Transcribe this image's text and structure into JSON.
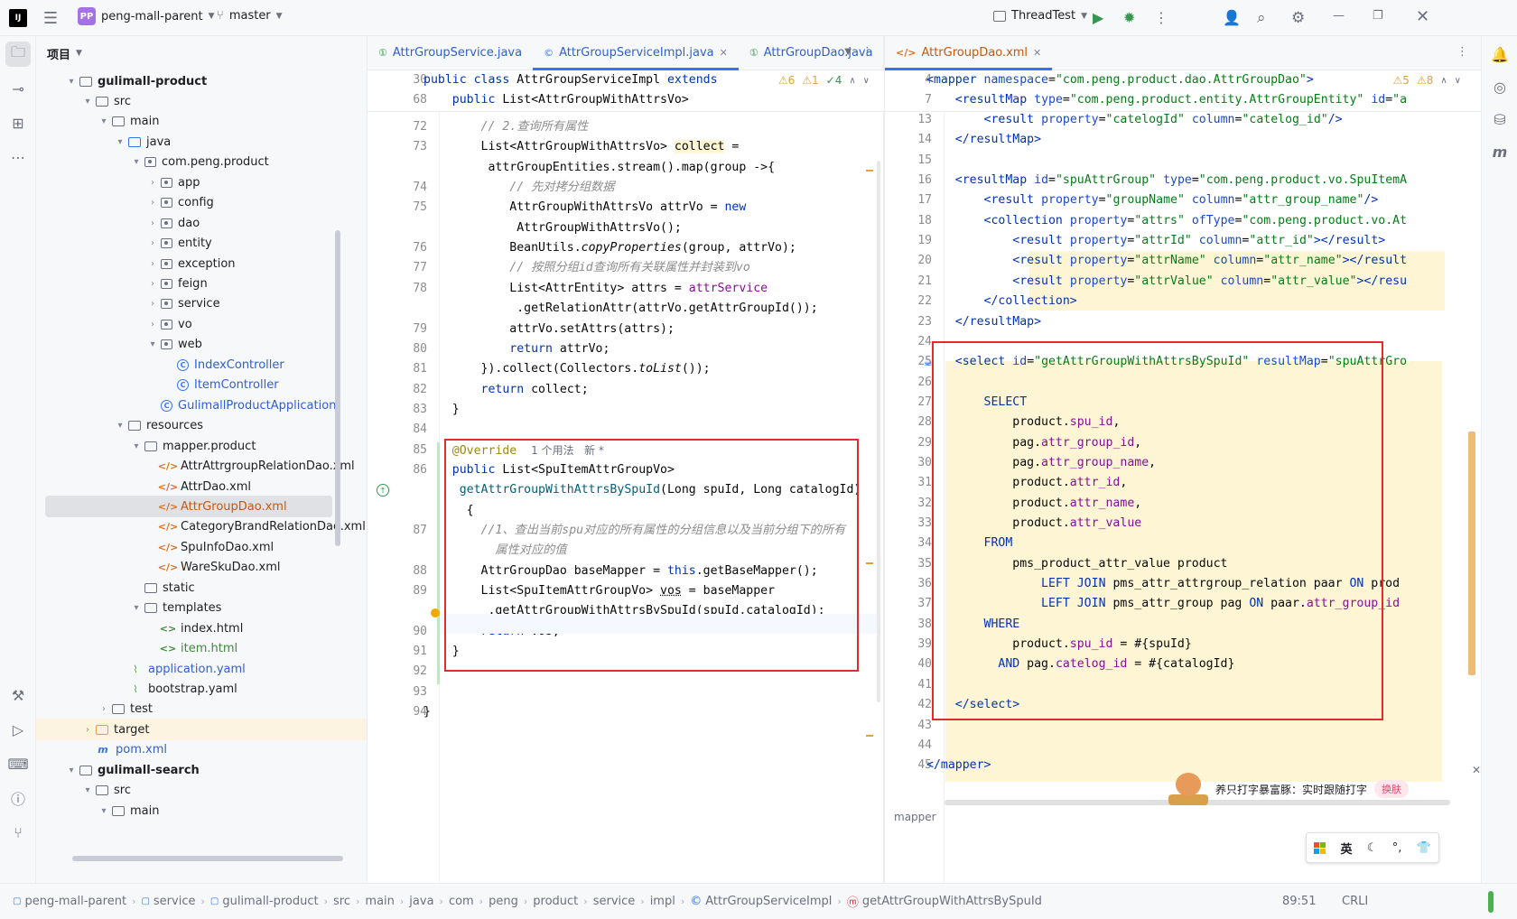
{
  "titlebar": {
    "project_badge": "PP",
    "project_name": "peng-mall-parent",
    "branch": "master",
    "run_config": "ThreadTest"
  },
  "project_panel": {
    "title": "项目",
    "tree": [
      {
        "label": "gulimall-product",
        "depth": 2,
        "icon": "folder",
        "arrow": "▾",
        "bold": true
      },
      {
        "label": "src",
        "depth": 3,
        "icon": "folder",
        "arrow": "▾"
      },
      {
        "label": "main",
        "depth": 4,
        "icon": "folder",
        "arrow": "▾"
      },
      {
        "label": "java",
        "depth": 5,
        "icon": "folder-blue",
        "arrow": "▾"
      },
      {
        "label": "com.peng.product",
        "depth": 6,
        "icon": "package",
        "arrow": "▾"
      },
      {
        "label": "app",
        "depth": 7,
        "icon": "package",
        "arrow": "›"
      },
      {
        "label": "config",
        "depth": 7,
        "icon": "package",
        "arrow": "›"
      },
      {
        "label": "dao",
        "depth": 7,
        "icon": "package",
        "arrow": "›"
      },
      {
        "label": "entity",
        "depth": 7,
        "icon": "package",
        "arrow": "›"
      },
      {
        "label": "exception",
        "depth": 7,
        "icon": "package",
        "arrow": "›"
      },
      {
        "label": "feign",
        "depth": 7,
        "icon": "package",
        "arrow": "›"
      },
      {
        "label": "service",
        "depth": 7,
        "icon": "package",
        "arrow": "›"
      },
      {
        "label": "vo",
        "depth": 7,
        "icon": "package",
        "arrow": "›"
      },
      {
        "label": "web",
        "depth": 7,
        "icon": "package",
        "arrow": "▾"
      },
      {
        "label": "IndexController",
        "depth": 8,
        "icon": "class",
        "arrow": "",
        "blue": true
      },
      {
        "label": "ItemController",
        "depth": 8,
        "icon": "class",
        "arrow": "",
        "blue": true
      },
      {
        "label": "GulimallProductApplication",
        "depth": 7,
        "icon": "class",
        "arrow": "",
        "blue": true
      },
      {
        "label": "resources",
        "depth": 5,
        "icon": "folder",
        "arrow": "▾"
      },
      {
        "label": "mapper.product",
        "depth": 6,
        "icon": "folder",
        "arrow": "▾"
      },
      {
        "label": "AttrAttrgroupRelationDao.xml",
        "depth": 7,
        "icon": "xml",
        "arrow": ""
      },
      {
        "label": "AttrDao.xml",
        "depth": 7,
        "icon": "xml",
        "arrow": ""
      },
      {
        "label": "AttrGroupDao.xml",
        "depth": 7,
        "icon": "xml",
        "arrow": "",
        "selected": true,
        "orange": true
      },
      {
        "label": "CategoryBrandRelationDao.xml",
        "depth": 7,
        "icon": "xml",
        "arrow": ""
      },
      {
        "label": "SpuInfoDao.xml",
        "depth": 7,
        "icon": "xml",
        "arrow": ""
      },
      {
        "label": "WareSkuDao.xml",
        "depth": 7,
        "icon": "xml",
        "arrow": ""
      },
      {
        "label": "static",
        "depth": 6,
        "icon": "folder",
        "arrow": ""
      },
      {
        "label": "templates",
        "depth": 6,
        "icon": "folder",
        "arrow": "▾"
      },
      {
        "label": "index.html",
        "depth": 7,
        "icon": "html",
        "arrow": ""
      },
      {
        "label": "item.html",
        "depth": 7,
        "icon": "html",
        "arrow": "",
        "green": true
      },
      {
        "label": "application.yaml",
        "depth": 5,
        "icon": "yaml",
        "arrow": "",
        "blue": true
      },
      {
        "label": "bootstrap.yaml",
        "depth": 5,
        "icon": "yaml",
        "arrow": ""
      },
      {
        "label": "test",
        "depth": 4,
        "icon": "folder",
        "arrow": "›"
      },
      {
        "label": "target",
        "depth": 3,
        "icon": "folder-orange",
        "arrow": "›",
        "highlight": true
      },
      {
        "label": "pom.xml",
        "depth": 3,
        "icon": "maven",
        "arrow": "",
        "blue": true
      },
      {
        "label": "gulimall-search",
        "depth": 2,
        "icon": "folder",
        "arrow": "▾",
        "bold": true
      },
      {
        "label": "src",
        "depth": 3,
        "icon": "folder",
        "arrow": "▾"
      },
      {
        "label": "main",
        "depth": 4,
        "icon": "folder",
        "arrow": "▾"
      }
    ]
  },
  "left_tabs": [
    {
      "label": "AttrGroupService.java",
      "icon": "interface"
    },
    {
      "label": "AttrGroupServiceImpl.java",
      "icon": "class",
      "active": true
    },
    {
      "label": "AttrGroupDao.java",
      "icon": "interface"
    }
  ],
  "right_tabs": [
    {
      "label": "AttrGroupDao.xml",
      "icon": "xml",
      "active": true
    }
  ],
  "left_editor": {
    "inspections": {
      "warn1": "6",
      "warn2": "1",
      "ok": "4"
    },
    "sticky": [
      {
        "ln": "30",
        "html": "<span class='kw'>public class</span> AttrGroupServiceImpl <span class='kw'>extends</span>"
      },
      {
        "ln": "68",
        "html": "    <span class='kw'>public</span> List&lt;AttrGroupWithAttrsVo&gt;"
      }
    ],
    "lines": [
      {
        "ln": "72",
        "html": "        <span class='cm'>// 2.查询所有属性</span>"
      },
      {
        "ln": "73",
        "html": "        List&lt;AttrGroupWithAttrsVo&gt; <span style='background:#fdf5d4'>collect</span> ="
      },
      {
        "ln": "",
        "html": "         attrGroupEntities.stream().map(group -&gt;{"
      },
      {
        "ln": "74",
        "html": "            <span class='cm'>// 先对拷分组数据</span>"
      },
      {
        "ln": "75",
        "html": "            AttrGroupWithAttrsVo attrVo = <span class='kw'>new</span>"
      },
      {
        "ln": "",
        "html": "             AttrGroupWithAttrsVo();"
      },
      {
        "ln": "76",
        "html": "            BeanUtils.<span class='ital'>copyProperties</span>(group, attrVo);"
      },
      {
        "ln": "77",
        "html": "            <span class='cm'>// 按照分组id查询所有关联属性并封装到vo</span>"
      },
      {
        "ln": "78",
        "html": "            List&lt;AttrEntity&gt; attrs = <span class='fld'>attrService</span>"
      },
      {
        "ln": "",
        "html": "             .getRelationAttr(attrVo.getAttrGroupId());"
      },
      {
        "ln": "79",
        "html": "            attrVo.setAttrs(attrs);"
      },
      {
        "ln": "80",
        "html": "            <span class='kw'>return</span> attrVo;"
      },
      {
        "ln": "81",
        "html": "        }).collect(Collectors.<span class='ital'>toList</span>());"
      },
      {
        "ln": "82",
        "html": "        <span class='kw'>return</span> collect;"
      },
      {
        "ln": "83",
        "html": "    }"
      },
      {
        "ln": "84",
        "html": ""
      },
      {
        "ln": "85",
        "html": "    <span class='an'>@Override</span>  <span style='color:#6c707e;font-family:DejaVu Sans,sans-serif;font-size:12px'>1 个用法   新 *</span>"
      },
      {
        "ln": "86",
        "html": "    <span class='kw'>public</span> List&lt;SpuItemAttrGroupVo&gt;"
      },
      {
        "ln": "",
        "html": "     <span class='mth'>getAttrGroupWithAttrsBySpuId</span>(Long spuId, Long catalogId)"
      },
      {
        "ln": "",
        "html": "      {"
      },
      {
        "ln": "87",
        "html": "        <span class='cm'>//1、查出当前spu对应的所有属性的分组信息以及当前分组下的所有</span>"
      },
      {
        "ln": "",
        "html": "          <span class='cm'>属性对应的值</span>"
      },
      {
        "ln": "88",
        "html": "        AttrGroupDao baseMapper = <span class='kw'>this</span>.getBaseMapper();"
      },
      {
        "ln": "89",
        "html": "        List&lt;SpuItemAttrGroupVo&gt; <span style='text-decoration:underline dotted'>vos</span> = baseMapper"
      },
      {
        "ln": "",
        "html": "         .getAttrGroupWithAttrsBySpuId(spuId,catalogId);"
      },
      {
        "ln": "90",
        "html": "        <span class='kw'>return</span> vos;"
      },
      {
        "ln": "91",
        "html": "    }"
      },
      {
        "ln": "92",
        "html": ""
      },
      {
        "ln": "93",
        "html": ""
      },
      {
        "ln": "94",
        "html": "}"
      }
    ]
  },
  "right_editor": {
    "inspections": {
      "warn": "5",
      "ok": "8"
    },
    "sticky": [
      {
        "ln": "4",
        "html": "<span class='tg'>&lt;mapper</span> <span class='at'>namespace</span>=<span class='str'>\"com.peng.product.dao.AttrGroupDao\"</span><span class='tg'>&gt;</span>"
      },
      {
        "ln": "7",
        "html": "    <span class='tg'>&lt;resultMap</span> <span class='at'>type</span>=<span class='str'>\"com.peng.product.entity.AttrGroupEntity\"</span> <span class='at'>id</span>=<span class='str'>\"a</span>"
      }
    ],
    "lines": [
      {
        "ln": "13",
        "html": "        <span class='tg'>&lt;result</span> <span class='at'>property</span>=<span class='str'>\"catelogId\"</span> <span class='at'>column</span>=<span class='str'>\"catelog_id\"</span><span class='tg'>/&gt;</span>"
      },
      {
        "ln": "14",
        "html": "    <span class='tg'>&lt;/resultMap&gt;</span>"
      },
      {
        "ln": "15",
        "html": ""
      },
      {
        "ln": "16",
        "html": "    <span class='tg'>&lt;resultMap</span> <span class='at'>id</span>=<span class='str'>\"spuAttrGroup\"</span> <span class='at'>type</span>=<span class='str'>\"com.peng.product.vo.SpuItemA</span>"
      },
      {
        "ln": "17",
        "html": "        <span class='tg'>&lt;result</span> <span class='at'>property</span>=<span class='str'>\"groupName\"</span> <span class='at'>column</span>=<span class='str'>\"attr_group_name\"</span><span class='tg'>/&gt;</span>"
      },
      {
        "ln": "18",
        "html": "        <span class='tg'>&lt;collection</span> <span class='at'>property</span>=<span class='str'>\"attrs\"</span> <span class='at'>ofType</span>=<span class='str'>\"com.peng.product.vo.At</span>"
      },
      {
        "ln": "19",
        "html": "            <span class='tg'>&lt;result</span> <span class='at'>property</span>=<span class='str'>\"attrId\"</span> <span class='at'>column</span>=<span class='str'>\"attr_id\"</span><span class='tg'>&gt;&lt;/result&gt;</span>"
      },
      {
        "ln": "20",
        "html": "            <span class='tg'>&lt;result</span> <span class='at'>property</span>=<span class='str'>\"attrName\"</span> <span class='at'>column</span>=<span class='str'>\"attr_name\"</span><span class='tg'>&gt;&lt;/result</span>"
      },
      {
        "ln": "21",
        "html": "            <span class='tg'>&lt;result</span> <span class='at'>property</span>=<span class='str'>\"attrValue\"</span> <span class='at'>column</span>=<span class='str'>\"attr_value\"</span><span class='tg'>&gt;&lt;/resu</span>"
      },
      {
        "ln": "22",
        "html": "        <span class='tg'>&lt;/collection&gt;</span>"
      },
      {
        "ln": "23",
        "html": "    <span class='tg'>&lt;/resultMap&gt;</span>"
      },
      {
        "ln": "24",
        "html": ""
      },
      {
        "ln": "25",
        "html": "    <span class='tg'>&lt;select</span> <span class='at'>id</span>=<span class='str'>\"getAttrGroupWithAttrsBySpuId\"</span> <span class='at'>resultMap</span>=<span class='str'>\"spuAttrGro</span>"
      },
      {
        "ln": "26",
        "html": ""
      },
      {
        "ln": "27",
        "html": "        <span class='kw'>SELECT</span>"
      },
      {
        "ln": "28",
        "html": "            product.<span class='col'>spu_id</span>,"
      },
      {
        "ln": "29",
        "html": "            pag.<span class='col'>attr_group_id</span>,"
      },
      {
        "ln": "30",
        "html": "            pag.<span class='col'>attr_group_name</span>,"
      },
      {
        "ln": "31",
        "html": "            product.<span class='col'>attr_id</span>,"
      },
      {
        "ln": "32",
        "html": "            product.<span class='col'>attr_name</span>,"
      },
      {
        "ln": "33",
        "html": "            product.<span class='col'>attr_value</span>"
      },
      {
        "ln": "34",
        "html": "        <span class='kw'>FROM</span>"
      },
      {
        "ln": "35",
        "html": "            pms_product_attr_value product"
      },
      {
        "ln": "36",
        "html": "                <span class='kw'>LEFT JOIN</span> pms_attr_attrgroup_relation paar <span class='kw'>ON</span> prod"
      },
      {
        "ln": "37",
        "html": "                <span class='kw'>LEFT JOIN</span> pms_attr_group pag <span class='kw'>ON</span> paar.<span class='col'>attr_group_id</span>"
      },
      {
        "ln": "38",
        "html": "        <span class='kw'>WHERE</span>"
      },
      {
        "ln": "39",
        "html": "            product.<span class='col'>spu_id</span> = #{spuId}"
      },
      {
        "ln": "40",
        "html": "          <span class='kw'>AND</span> pag.<span class='col'>catelog_id</span> = #{catalogId}"
      },
      {
        "ln": "41",
        "html": ""
      },
      {
        "ln": "42",
        "html": "    <span class='tg'>&lt;/select&gt;</span>"
      },
      {
        "ln": "43",
        "html": ""
      },
      {
        "ln": "44",
        "html": ""
      },
      {
        "ln": "45",
        "html": "<span class='tg'>&lt;/mapper&gt;</span>"
      }
    ],
    "footer_breadcrumb": "mapper"
  },
  "ime_popup": {
    "text": "养只打字暴富豚：实时跟随打字",
    "button": "换肤",
    "toolbar_lang": "英"
  },
  "statusbar": {
    "crumbs": [
      "peng-mall-parent",
      "service",
      "gulimall-product",
      "src",
      "main",
      "java",
      "com",
      "peng",
      "product",
      "service",
      "impl",
      "AttrGroupServiceImpl",
      "getAttrGroupWithAttrsBySpuId"
    ],
    "position": "89:51",
    "line_ending": "CRLI"
  },
  "colors": {
    "accent": "#3574f0",
    "redbox": "#e32b2b",
    "highlight": "#fdf5d4"
  }
}
